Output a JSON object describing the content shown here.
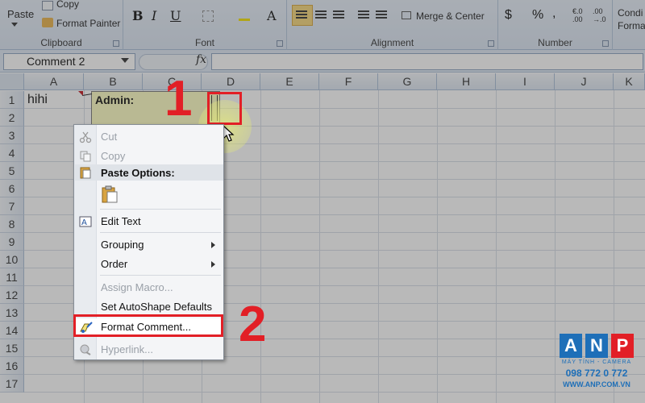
{
  "ribbon": {
    "clipboard": {
      "paste": "Paste",
      "copy": "Copy",
      "format_painter": "Format Painter",
      "group_label": "Clipboard"
    },
    "font": {
      "bold": "B",
      "italic": "I",
      "underline": "U",
      "group_label": "Font"
    },
    "alignment": {
      "merge_center": "Merge & Center",
      "group_label": "Alignment"
    },
    "number": {
      "currency": "$",
      "percent": "%",
      "comma": ",",
      "group_label": "Number"
    },
    "styles": {
      "conditional_1": "Condi",
      "conditional_2": "Forma"
    }
  },
  "formula_bar": {
    "name_box": "Comment 2",
    "fx": "fx"
  },
  "grid": {
    "columns": [
      "A",
      "B",
      "C",
      "D",
      "E",
      "F",
      "G",
      "H",
      "I",
      "J",
      "K"
    ],
    "rows": [
      "1",
      "2",
      "3",
      "4",
      "5",
      "6",
      "7",
      "8",
      "9",
      "10",
      "11",
      "12",
      "13",
      "14",
      "15",
      "16",
      "17"
    ],
    "cell_a1": "hihi"
  },
  "comment": {
    "author": "Admin:"
  },
  "context_menu": {
    "cut": "Cut",
    "copy": "Copy",
    "paste_options": "Paste Options:",
    "edit_text": "Edit Text",
    "grouping": "Grouping",
    "order": "Order",
    "assign_macro": "Assign Macro...",
    "set_autoshape_defaults": "Set AutoShape Defaults",
    "format_comment": "Format Comment...",
    "hyperlink": "Hyperlink..."
  },
  "steps": {
    "step1": "1",
    "step2": "2"
  },
  "watermark": {
    "a": "A",
    "n": "N",
    "p": "P",
    "line1": "MÁY TÍNH - CAMERA",
    "line2": "098 772 0 772",
    "line3": "WWW.ANP.COM.VN"
  },
  "colors": {
    "highlight_red": "#e21f26",
    "comment_bg": "#ffffc4",
    "brand_blue": "#1e6fb8"
  }
}
